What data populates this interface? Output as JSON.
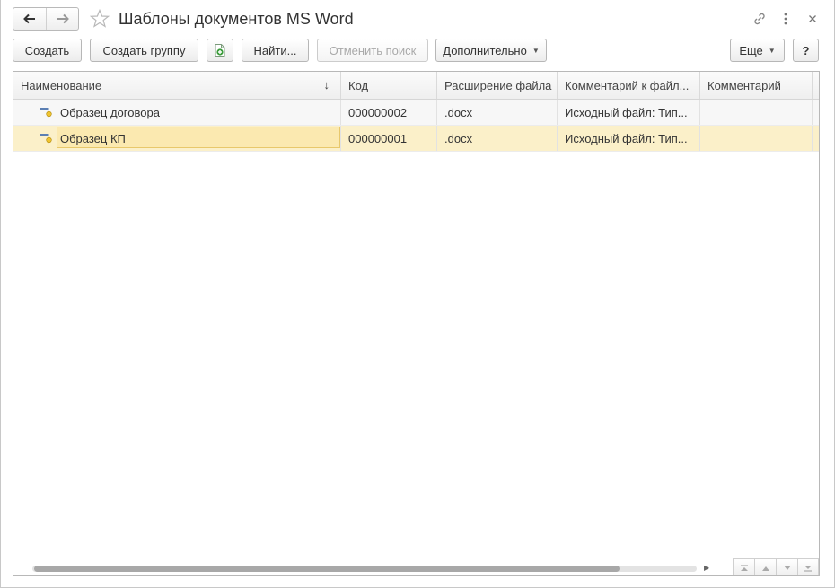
{
  "window": {
    "title": "Шаблоны документов MS Word"
  },
  "toolbar": {
    "create_label": "Создать",
    "create_group_label": "Создать группу",
    "find_label": "Найти...",
    "cancel_search_label": "Отменить поиск",
    "more_actions_label": "Дополнительно",
    "esche_label": "Еще",
    "help_label": "?"
  },
  "table": {
    "columns": [
      {
        "label": "Наименование",
        "sort": "↓"
      },
      {
        "label": "Код"
      },
      {
        "label": "Расширение файла"
      },
      {
        "label": "Комментарий к файл..."
      },
      {
        "label": "Комментарий"
      }
    ],
    "rows": [
      {
        "name": "Образец договора",
        "code": "000000002",
        "ext": ".docx",
        "file_comment": "Исходный файл: Тип...",
        "comment": "",
        "selected": false
      },
      {
        "name": "Образец КП",
        "code": "000000001",
        "ext": ".docx",
        "file_comment": "Исходный файл: Тип...",
        "comment": "",
        "selected": true
      }
    ]
  },
  "scroll": {
    "horizontal_position": 0.88
  },
  "colors": {
    "selected_row": "#fbf0c9",
    "edit_border": "#e8c86b",
    "icon_accent": "#f0c430",
    "icon_blue": "#5b7fb3",
    "add_green": "#3b9c3b"
  },
  "icons": {
    "back": "arrow-left-icon",
    "forward": "arrow-right-icon",
    "favorite": "star-icon",
    "link": "link-icon",
    "more": "vertical-dots-icon",
    "close": "close-icon",
    "add_doc": "add-document-icon",
    "row_item": "catalog-item-icon"
  }
}
